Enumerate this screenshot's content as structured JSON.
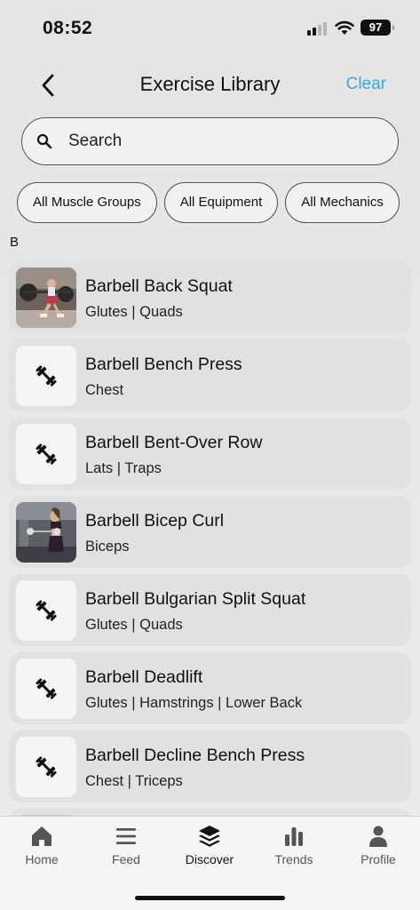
{
  "status_bar": {
    "time": "08:52",
    "battery": "97"
  },
  "header": {
    "title": "Exercise Library",
    "clear_label": "Clear"
  },
  "search": {
    "placeholder": "Search",
    "value": ""
  },
  "filters": [
    {
      "label": "All Muscle Groups"
    },
    {
      "label": "All Equipment"
    },
    {
      "label": "All Mechanics"
    }
  ],
  "section_letter": "B",
  "exercises": [
    {
      "name": "Barbell Back Squat",
      "muscles": "Glutes | Quads",
      "thumb": "photo-squat"
    },
    {
      "name": "Barbell Bench Press",
      "muscles": "Chest",
      "thumb": "barbell-icon"
    },
    {
      "name": "Barbell Bent-Over Row",
      "muscles": "Lats | Traps",
      "thumb": "barbell-icon"
    },
    {
      "name": "Barbell Bicep Curl",
      "muscles": "Biceps",
      "thumb": "photo-curl"
    },
    {
      "name": "Barbell Bulgarian Split Squat",
      "muscles": "Glutes | Quads",
      "thumb": "barbell-icon"
    },
    {
      "name": "Barbell Deadlift",
      "muscles": "Glutes | Hamstrings | Lower Back",
      "thumb": "barbell-icon"
    },
    {
      "name": "Barbell Decline Bench Press",
      "muscles": "Chest | Triceps",
      "thumb": "barbell-icon"
    }
  ],
  "tabs": [
    {
      "label": "Home",
      "icon": "home-icon",
      "active": false
    },
    {
      "label": "Feed",
      "icon": "menu-icon",
      "active": false
    },
    {
      "label": "Discover",
      "icon": "layers-icon",
      "active": true
    },
    {
      "label": "Trends",
      "icon": "bar-chart-icon",
      "active": false
    },
    {
      "label": "Profile",
      "icon": "person-icon",
      "active": false
    }
  ],
  "colors": {
    "accent": "#3da6d9",
    "background": "#e7e7e7",
    "row": "#e1e1e1"
  }
}
